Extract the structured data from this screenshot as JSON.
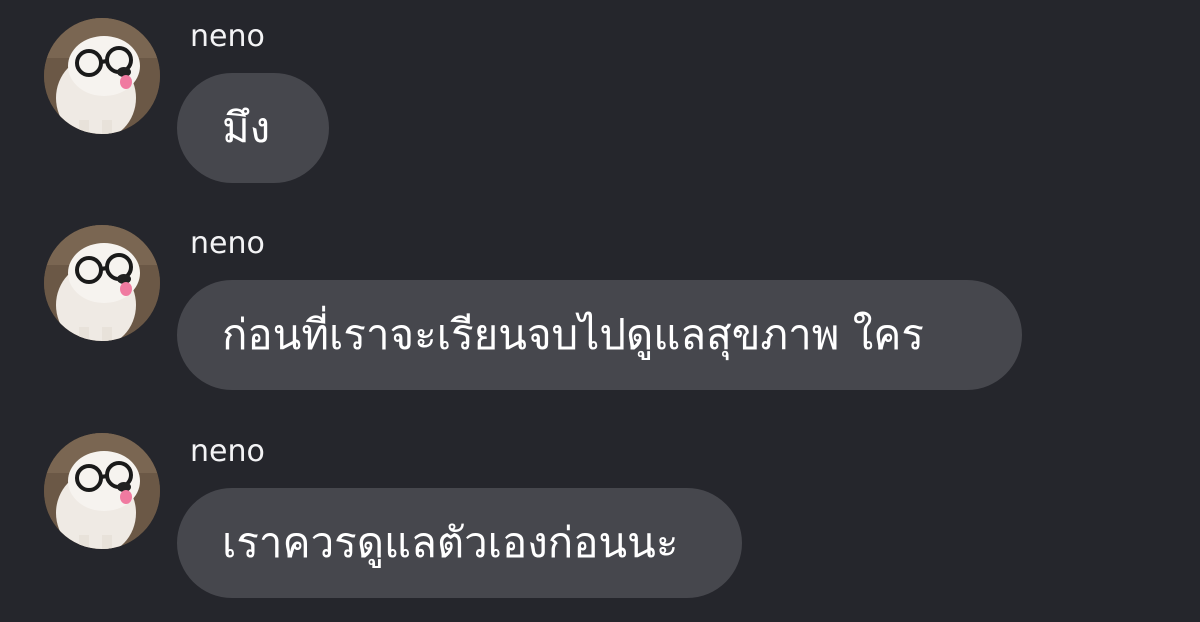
{
  "colors": {
    "background": "#25262c",
    "bubble": "#46474d",
    "text": "#ffffff",
    "sender": "#f3f3f5"
  },
  "messages": [
    {
      "sender": "neno",
      "avatar": "dog-with-glasses-avatar",
      "text": "มึง"
    },
    {
      "sender": "neno",
      "avatar": "dog-with-glasses-avatar",
      "text": "ก่อนที่เราจะเรียนจบไปดูแลสุขภาพ ใคร"
    },
    {
      "sender": "neno",
      "avatar": "dog-with-glasses-avatar",
      "text": "เราควรดูแลตัวเองก่อนนะ"
    }
  ]
}
